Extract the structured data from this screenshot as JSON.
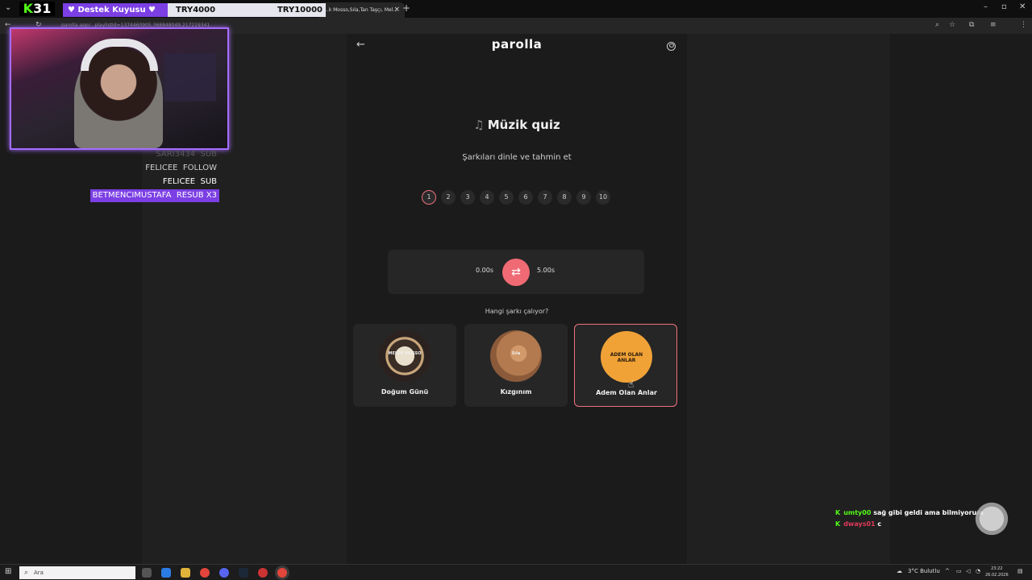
{
  "browser": {
    "tab_title": "...k Mosso,Sıla,Tan Taşçı, Mel...",
    "url": "parolla.app/...playlistId=1374460905,368848049,217219341",
    "tab_close": "×",
    "new_tab": "+"
  },
  "overlay": {
    "logo_k": "K",
    "logo_num": "31",
    "donation_title": "♥ Destek Kuyusu ♥",
    "donation_current": "TRY4000",
    "donation_goal": "TRY10000",
    "events": [
      {
        "name": "SARI3434",
        "type": "SUB"
      },
      {
        "name": "FELICEE",
        "type": "FOLLOW"
      },
      {
        "name": "FELICEE",
        "type": "SUB"
      },
      {
        "name": "BETMENCIMUSTAFA",
        "type": "RESUB X3"
      }
    ]
  },
  "app": {
    "brand": "parolla",
    "title": "Müzik quiz",
    "subtitle": "Şarkıları dinle ve tahmin et",
    "steps": [
      "1",
      "2",
      "3",
      "4",
      "5",
      "6",
      "7",
      "8",
      "9",
      "10"
    ],
    "active_step": 1,
    "player": {
      "start": "0.00s",
      "end": "5.00s"
    },
    "question": "Hangi şarkı çalıyor?",
    "options": [
      {
        "label": "Doğum Günü",
        "cover_text": "MELEK MOSSO",
        "selected": false
      },
      {
        "label": "Kızgınım",
        "cover_text": "Sıla",
        "selected": false
      },
      {
        "label": "Adem Olan Anlar",
        "cover_text": "ADEM OLAN ANLAR",
        "selected": true
      }
    ]
  },
  "chat": [
    {
      "user": "umty00",
      "message": "sağ gibi geldi ama bilmiyorum"
    },
    {
      "user": "dways01",
      "message": "c"
    }
  ],
  "taskbar": {
    "search_placeholder": "Ara",
    "weather": "3°C  Bulutlu",
    "time": "23:22",
    "date": "26.02.2026"
  },
  "colors": {
    "accent": "#f06a74",
    "kick_green": "#53fc18",
    "purple": "#7b3fe4"
  }
}
